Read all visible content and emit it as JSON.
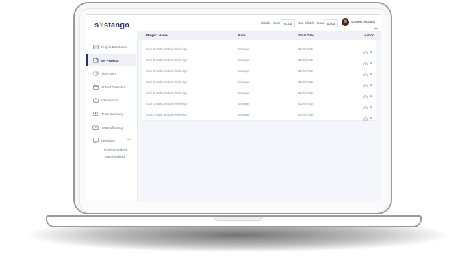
{
  "brand": {
    "logo_s": "s",
    "logo_y": "Y",
    "logo_rest": "stango"
  },
  "header": {
    "billable_label": "Billable Hours",
    "billable_value": "40:00",
    "non_billable_label": "Non Billable Hours",
    "non_billable_value": "00:00",
    "user_name": "Sameer Siddiqui"
  },
  "sidebar": {
    "items": [
      {
        "label": "Project Dashboard",
        "icon": "dashboard-icon"
      },
      {
        "label": "My Projects",
        "icon": "folder-icon",
        "active": true
      },
      {
        "label": "Time Entry",
        "icon": "clock-icon"
      },
      {
        "label": "Absent Calendar",
        "icon": "calendar-icon"
      },
      {
        "label": "Office Hours",
        "icon": "briefcase-icon"
      },
      {
        "label": "Team Summary",
        "icon": "team-icon"
      },
      {
        "label": "Team Efficiency",
        "icon": "efficiency-icon"
      },
      {
        "label": "Feedback",
        "icon": "feedback-icon"
      }
    ],
    "subitems": [
      {
        "label": "Project Feedback"
      },
      {
        "label": "Team Feedback"
      }
    ]
  },
  "table": {
    "columns": [
      "Project Name",
      "Role",
      "Start Date",
      "Action"
    ],
    "rows": [
      {
        "project": "Skin-O-Matic Website Redesign",
        "role": "Manager",
        "start": "01/08/2019"
      },
      {
        "project": "Skin-O-Matic Website Redesign",
        "role": "Manager",
        "start": "01/08/2019"
      },
      {
        "project": "Skin-O-Matic Website Redesign",
        "role": "Manager",
        "start": "01/08/2019"
      },
      {
        "project": "Skin-O-Matic Website Redesign",
        "role": "Manager",
        "start": "01/08/2019"
      },
      {
        "project": "Skin-O-Matic Website Redesign",
        "role": "Manager",
        "start": "01/08/2019"
      },
      {
        "project": "Skin-O-Matic Website Redesign",
        "role": "Manager",
        "start": "01/08/2019"
      },
      {
        "project": "Skin-O-Matic Website Redesign",
        "role": "Manager",
        "start": "01/08/2019"
      }
    ]
  },
  "colors": {
    "primary": "#27316b",
    "accent": "#f0a02a",
    "background": "#f4f6fb"
  }
}
